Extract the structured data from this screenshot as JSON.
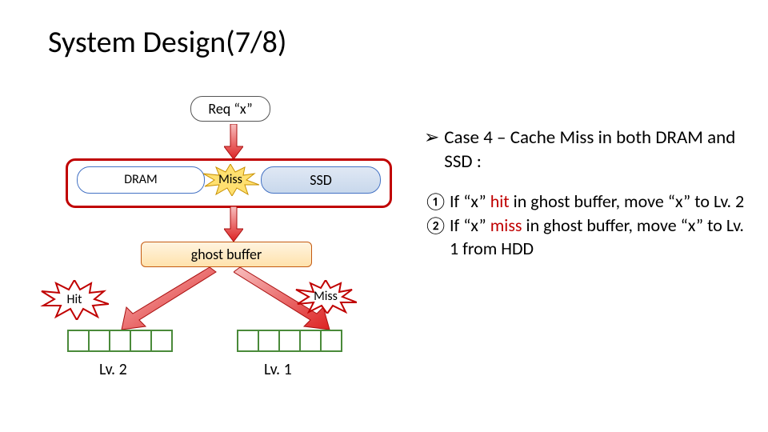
{
  "title": "System Design(7/8)",
  "req_label": "Req “x”",
  "dram_label": "DRAM",
  "ssd_label": "SSD",
  "miss_label_top": "Miss",
  "ghost_label": "ghost buffer",
  "hit_label": "Hit",
  "miss_label_bottom": "Miss",
  "lv2_label": "Lv. 2",
  "lv1_label": "Lv. 1",
  "bullet_chevron": "➢",
  "heading_line": "Case 4 – Cache Miss in both DRAM and SSD :",
  "step1_num": "①",
  "step1_pre": "If “x” ",
  "step1_hit": "hit",
  "step1_post": " in ghost buffer, move “x” to Lv. 2",
  "step2_num": "②",
  "step2_pre": "If “x” ",
  "step2_miss": "miss",
  "step2_post": " in ghost buffer, move “x” to Lv. 1 from HDD",
  "colors": {
    "red": "#c00000",
    "blue": "#4472C4",
    "orange": "#C55A11",
    "green": "#4a8a3a"
  }
}
